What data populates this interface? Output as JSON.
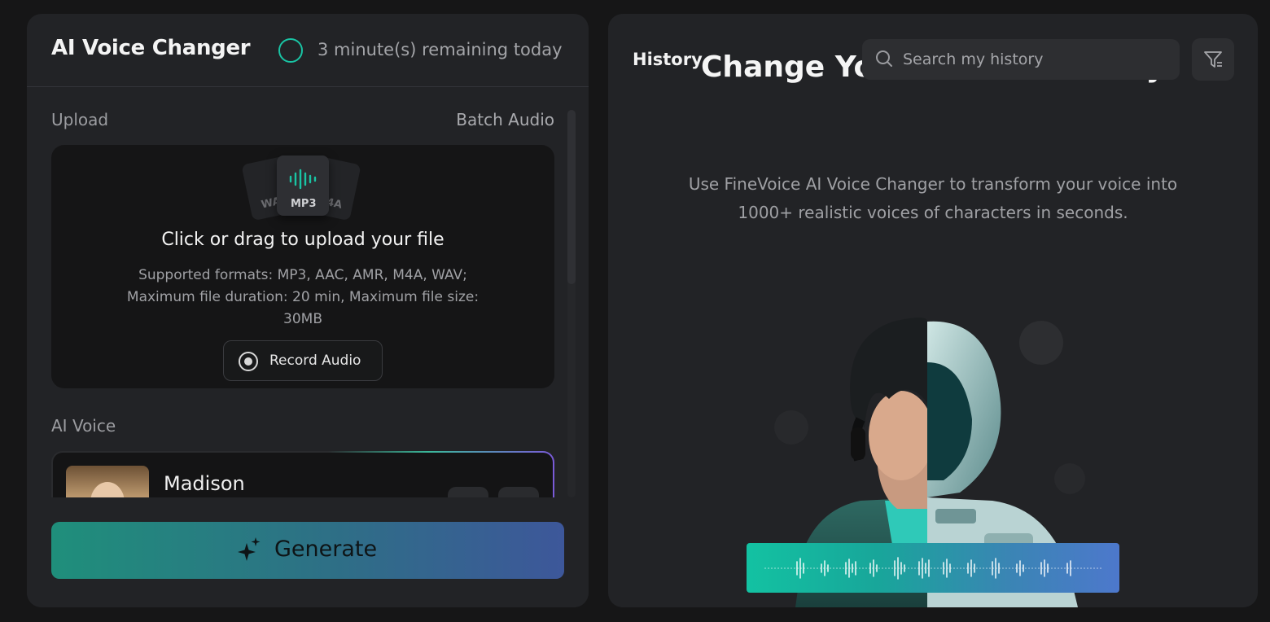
{
  "left_panel": {
    "title": "AI Voice Changer",
    "quota_text": "3 minute(s) remaining today",
    "upload": {
      "label": "Upload",
      "batch_label": "Batch Audio",
      "file_tags": [
        "WA",
        "MP3",
        "4A"
      ],
      "title": "Click or drag to upload your file",
      "info": "Supported formats: MP3, AAC, AMR, M4A, WAV; Maximum file duration: 20 min, Maximum file size: 30MB",
      "record_label": "Record Audio"
    },
    "ai_voice": {
      "label": "AI Voice",
      "selected_voice": "Madison"
    },
    "generate_label": "Generate"
  },
  "right_panel": {
    "history_label": "History",
    "hero_title": "Change Your Voice Instantly",
    "search_placeholder": "Search my history",
    "description": "Use FineVoice AI Voice Changer to transform your voice into 1000+ realistic voices of characters in seconds."
  },
  "colors": {
    "accent_teal": "#19c4a4",
    "accent_blue": "#4d78cc",
    "panel_bg": "#222326",
    "page_bg": "#161617"
  },
  "icons": [
    "search-icon",
    "filter-icon",
    "record-icon",
    "sparkle-icon",
    "audio-file-icon"
  ]
}
